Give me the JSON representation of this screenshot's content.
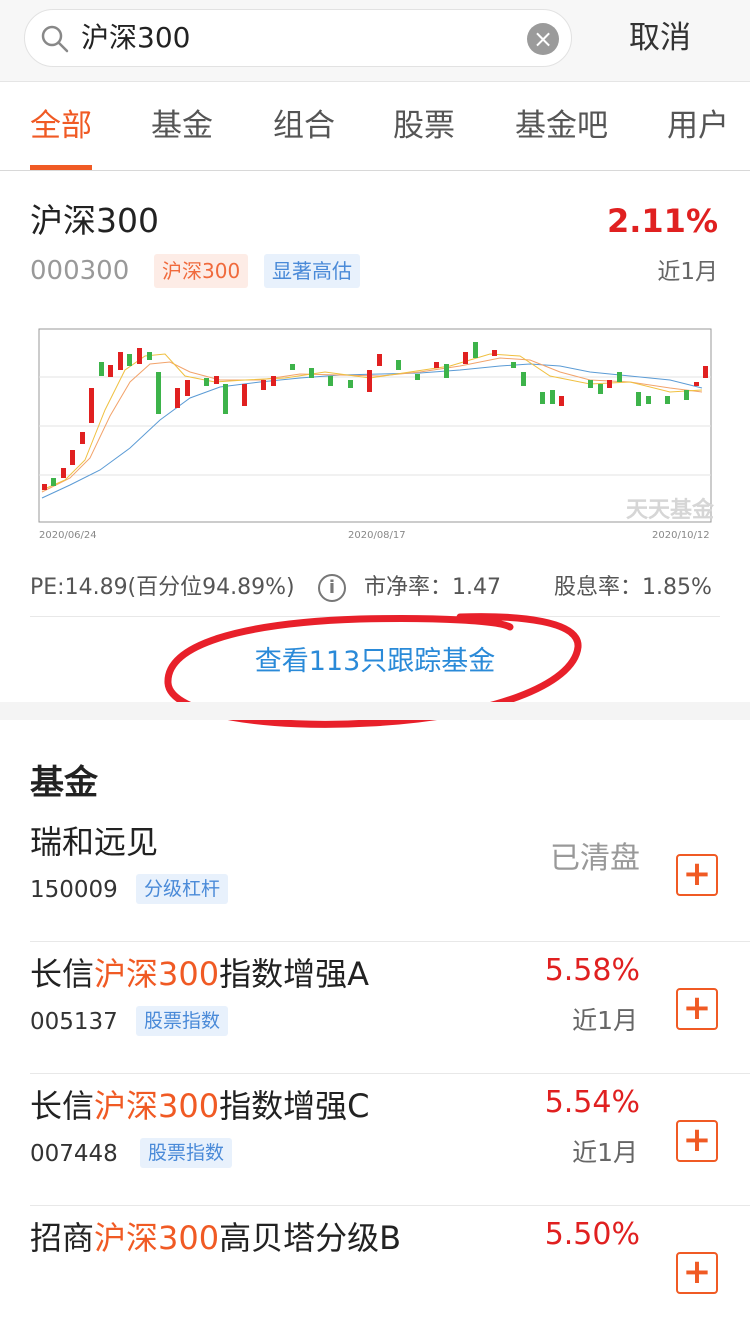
{
  "search": {
    "query": "沪深300",
    "cancel_label": "取消"
  },
  "tabs": [
    {
      "label": "全部",
      "active": true
    },
    {
      "label": "基金",
      "active": false
    },
    {
      "label": "组合",
      "active": false
    },
    {
      "label": "股票",
      "active": false
    },
    {
      "label": "基金吧",
      "active": false
    },
    {
      "label": "用户",
      "active": false
    }
  ],
  "index": {
    "name": "沪深300",
    "change": "2.11%",
    "code": "000300",
    "tags": [
      "沪深300",
      "显著高估"
    ],
    "period": "近1月",
    "chart": {
      "x_labels": [
        "2020/06/24",
        "2020/08/17",
        "2020/10/12"
      ],
      "watermark": "天天基金"
    },
    "metrics": {
      "pe": "PE:14.89(百分位94.89%)",
      "pb": "市净率：1.47",
      "dividend": "股息率：1.85%"
    },
    "track_link": "查看113只跟踪基金"
  },
  "section_title": "基金",
  "funds": [
    {
      "name_pre": "瑞和远见",
      "name_hl": "",
      "name_post": "",
      "code": "150009",
      "tag": "分级杠杆",
      "value": "已清盘",
      "period": ""
    },
    {
      "name_pre": "长信",
      "name_hl": "沪深300",
      "name_post": "指数增强A",
      "code": "005137",
      "tag": "股票指数",
      "value": "5.58%",
      "period": "近1月"
    },
    {
      "name_pre": "长信",
      "name_hl": "沪深300",
      "name_post": "指数增强C",
      "code": "007448",
      "tag": "股票指数",
      "value": "5.54%",
      "period": "近1月"
    },
    {
      "name_pre": "招商",
      "name_hl": "沪深300",
      "name_post": "高贝塔分级B",
      "code": "",
      "tag": "",
      "value": "5.50%",
      "period": ""
    }
  ],
  "colors": {
    "accent": "#f05a24",
    "up": "#e02020",
    "down": "#3db34a",
    "link": "#2a8ad8"
  },
  "icons": {
    "search": "search-icon",
    "clear": "clear-icon",
    "info": "info-icon",
    "add": "plus-icon"
  }
}
